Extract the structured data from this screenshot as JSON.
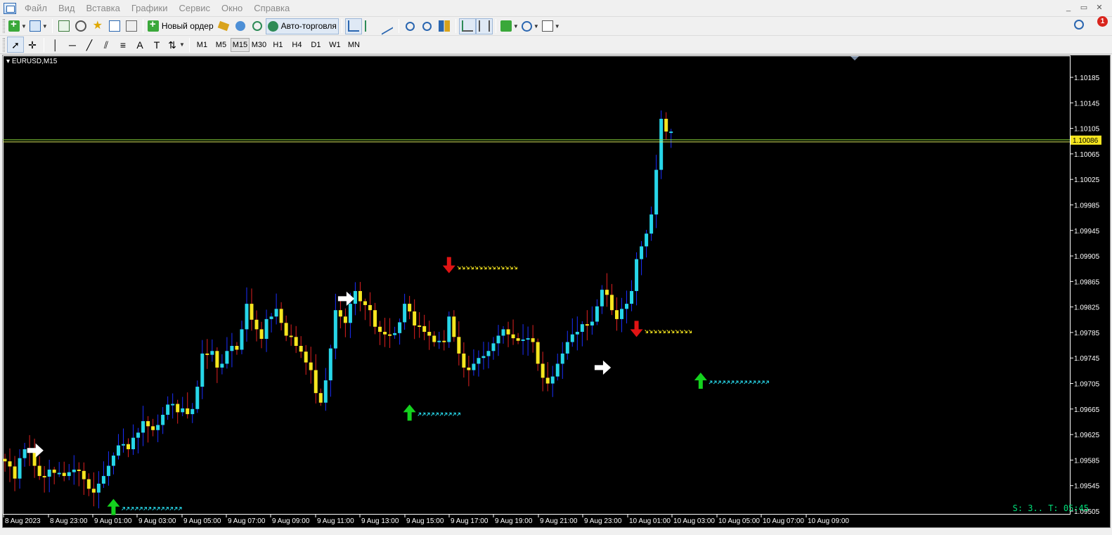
{
  "menu": {
    "items": [
      "Файл",
      "Вид",
      "Вставка",
      "Графики",
      "Сервис",
      "Окно",
      "Справка"
    ]
  },
  "window_controls": {
    "minimize": "_",
    "restore": "▭",
    "close": "✕"
  },
  "toolbar": {
    "new_order_label": "Новый ордер",
    "autotrading_label": "Авто-торговля",
    "notification_count": "1"
  },
  "timeframes": [
    "M1",
    "M5",
    "M15",
    "M30",
    "H1",
    "H4",
    "D1",
    "W1",
    "MN"
  ],
  "active_timeframe": "M15",
  "chart": {
    "title": "EURUSD,M15",
    "status": "S: 3.. T: 05:45"
  },
  "chart_data": {
    "type": "candlestick",
    "symbol": "EURUSD",
    "timeframe": "M15",
    "y_ticks": [
      "1.10185",
      "1.10145",
      "1.10105",
      "1.10065",
      "1.10025",
      "1.09985",
      "1.09945",
      "1.09905",
      "1.09865",
      "1.09825",
      "1.09785",
      "1.09745",
      "1.09705",
      "1.09665",
      "1.09625",
      "1.09585",
      "1.09545",
      "1.09505"
    ],
    "ylim": [
      1.09505,
      1.10185
    ],
    "x_ticks": [
      "8 Aug 2023",
      "8 Aug 23:00",
      "9 Aug 01:00",
      "9 Aug 03:00",
      "9 Aug 05:00",
      "9 Aug 07:00",
      "9 Aug 09:00",
      "9 Aug 11:00",
      "9 Aug 13:00",
      "9 Aug 15:00",
      "9 Aug 17:00",
      "9 Aug 19:00",
      "9 Aug 21:00",
      "9 Aug 23:00",
      "10 Aug 01:00",
      "10 Aug 03:00",
      "10 Aug 05:00",
      "10 Aug 07:00",
      "10 Aug 09:00"
    ],
    "current_price": "1.10086",
    "current_price_value": 1.10086,
    "colors": {
      "bull": "#27d6e8",
      "bear": "#f5e51f",
      "bull_wick": "#1a2fff",
      "bear_wick": "#e02020",
      "price_line": "#8cdc3c",
      "price_label_bg": "#f5e51f",
      "arrow_up": "#14d21e",
      "arrow_down": "#e01414",
      "arrow_neutral": "#ffffff"
    },
    "closes": [
      1.09583,
      1.09575,
      1.09556,
      1.09588,
      1.09602,
      1.09598,
      1.09576,
      1.0956,
      1.09559,
      1.0957,
      1.09565,
      1.09565,
      1.0956,
      1.09566,
      1.0957,
      1.09568,
      1.09555,
      1.0954,
      1.09534,
      1.09548,
      1.0956,
      1.09576,
      1.09592,
      1.09608,
      1.0961,
      1.09602,
      1.0962,
      1.09628,
      1.09646,
      1.09638,
      1.09632,
      1.0964,
      1.09656,
      1.09672,
      1.09673,
      1.0966,
      1.09666,
      1.09657,
      1.09665,
      1.097,
      1.09752,
      1.0975,
      1.09756,
      1.0973,
      1.09736,
      1.09756,
      1.09764,
      1.09758,
      1.0979,
      1.0983,
      1.09805,
      1.0979,
      1.09775,
      1.09806,
      1.0981,
      1.09822,
      1.098,
      1.0978,
      1.09778,
      1.09764,
      1.09755,
      1.09738,
      1.09726,
      1.0969,
      1.09675,
      1.0971,
      1.0976,
      1.0982,
      1.0981,
      1.098,
      1.0983,
      1.0985,
      1.09834,
      1.09828,
      1.0982,
      1.09794,
      1.09786,
      1.09782,
      1.09781,
      1.09784,
      1.09801,
      1.0983,
      1.09818,
      1.09796,
      1.09795,
      1.09786,
      1.0978,
      1.0977,
      1.09772,
      1.0977,
      1.0981,
      1.09778,
      1.09752,
      1.0973,
      1.09726,
      1.09736,
      1.09745,
      1.09748,
      1.09756,
      1.09768,
      1.0978,
      1.0979,
      1.09782,
      1.09776,
      1.09772,
      1.09774,
      1.09776,
      1.0977,
      1.09736,
      1.09714,
      1.09705,
      1.09716,
      1.09736,
      1.09752,
      1.0977,
      1.09782,
      1.09786,
      1.09798,
      1.09796,
      1.09802,
      1.09826,
      1.09852,
      1.09844,
      1.0982,
      1.09806,
      1.09822,
      1.0983,
      1.0985,
      1.099,
      1.0992,
      1.0994,
      1.0997,
      1.1004,
      1.1012,
      1.101,
      1.101
    ],
    "signals": [
      {
        "kind": "right",
        "index": 6,
        "price": 1.096
      },
      {
        "kind": "up",
        "index": 22,
        "price": 1.09512,
        "dots_count": 14
      },
      {
        "kind": "right",
        "index": 69,
        "price": 1.09838
      },
      {
        "kind": "up",
        "index": 82,
        "price": 1.0966,
        "dots_count": 10
      },
      {
        "kind": "down",
        "index": 90,
        "price": 1.0989,
        "dots_count": 14
      },
      {
        "kind": "right",
        "index": 121,
        "price": 1.0973
      },
      {
        "kind": "down",
        "index": 128,
        "price": 1.0979,
        "dots_count": 11
      },
      {
        "kind": "up",
        "index": 141,
        "price": 1.0971,
        "dots_count": 14
      }
    ]
  }
}
